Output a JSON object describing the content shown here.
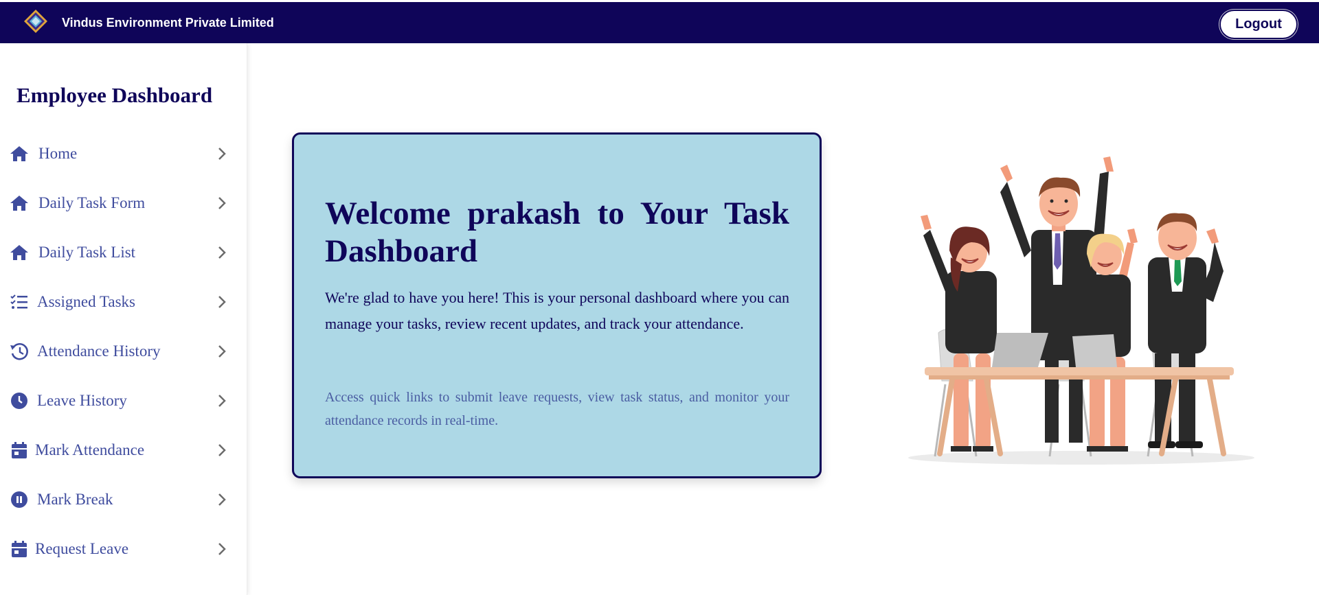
{
  "header": {
    "company_name": "Vindus Environment Private Limited",
    "logout_label": "Logout",
    "brand_color": "#0f0559",
    "logo_icon": "diamond-logo-icon"
  },
  "sidebar": {
    "title": "Employee Dashboard",
    "items": [
      {
        "label": "Home",
        "icon": "home-icon"
      },
      {
        "label": "Daily Task Form",
        "icon": "home-icon"
      },
      {
        "label": "Daily Task List",
        "icon": "home-icon"
      },
      {
        "label": "Assigned Tasks",
        "icon": "checklist-icon"
      },
      {
        "label": "Attendance History",
        "icon": "history-icon"
      },
      {
        "label": "Leave History",
        "icon": "clock-icon"
      },
      {
        "label": "Mark Attendance",
        "icon": "calendar-icon"
      },
      {
        "label": "Mark Break",
        "icon": "pause-icon"
      },
      {
        "label": "Request Leave",
        "icon": "calendar-icon"
      }
    ],
    "label_color": "#3f4c9e"
  },
  "main": {
    "welcome_title": "Welcome prakash to Your Task Dashboard",
    "welcome_text": "We're glad to have you here! This is your personal dashboard where you can manage your tasks, review recent updates, and track your attendance.",
    "welcome_subtext": "Access quick links to submit leave requests, view task status, and monitor your attendance records in real-time.",
    "card_color": "#add8e6",
    "illustration": "celebrating-team-illustration"
  }
}
